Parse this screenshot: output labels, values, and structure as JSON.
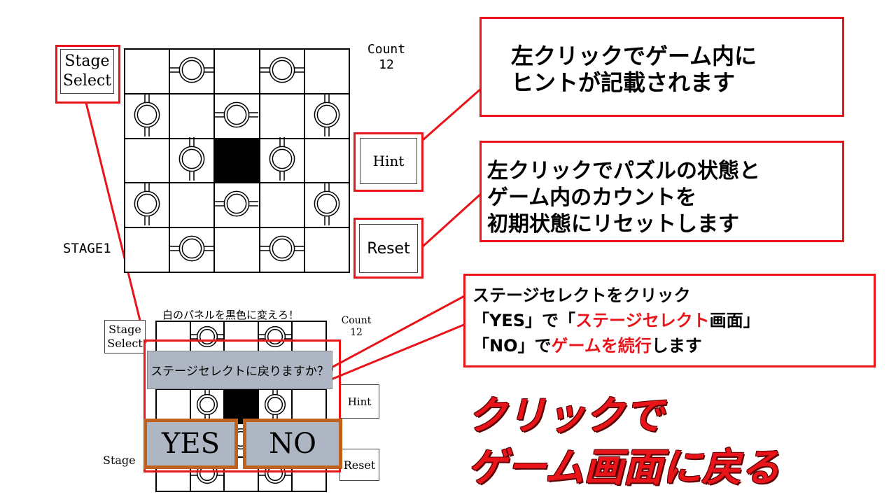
{
  "main": {
    "stage_select_label": [
      "Stage",
      "Select"
    ],
    "count_label": "Count",
    "count_value": "12",
    "hint_label": "Hint",
    "reset_label": "Reset",
    "stage_label": "STAGE1",
    "grid": {
      "rows": 5,
      "cols": 5,
      "cells": [
        [
          "empty",
          "h",
          "empty",
          "h",
          "empty"
        ],
        [
          "v",
          "empty",
          "h",
          "empty",
          "v"
        ],
        [
          "empty",
          "v",
          "black",
          "v",
          "empty"
        ],
        [
          "v",
          "empty",
          "h",
          "empty",
          "v"
        ],
        [
          "empty",
          "h",
          "empty",
          "h",
          "empty"
        ]
      ]
    }
  },
  "callouts": {
    "hint_lines": [
      "左クリックでゲーム内に",
      "ヒントが記載されます"
    ],
    "reset_lines": [
      "左クリックでパズルの状態と",
      "ゲーム内のカウントを",
      "初期状態にリセットします"
    ],
    "stage_select": {
      "line1": "ステージセレクトをクリック",
      "line2_a": "「YES」で「",
      "line2_red": "ステージセレクト",
      "line2_b": "画面」",
      "line3_a": "「NO」で",
      "line3_red": "ゲームを続行",
      "line3_b": "します"
    }
  },
  "preview": {
    "instruction": "白のパネルを黒色に変えろ！",
    "stage_select_label": [
      "Stage",
      "Select"
    ],
    "count_label": "Count",
    "count_value": "12",
    "hint_label": "Hint",
    "reset_label": "Reset",
    "stage_label": "Stage",
    "dialog_text": "ステージセレクトに戻りますか？",
    "yes_label": "YES",
    "no_label": "NO"
  },
  "big_text": {
    "line1": "クリックで",
    "line2": "ゲーム画面に戻る"
  },
  "colors": {
    "accent_red": "#e8141a",
    "button_border": "#c0621d",
    "dialog_bg": "#aeb6c4"
  }
}
